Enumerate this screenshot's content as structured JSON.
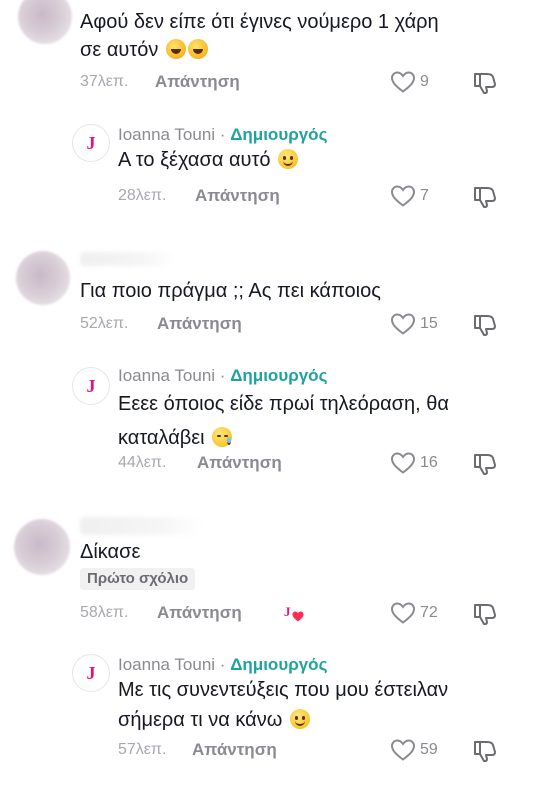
{
  "comments": [
    {
      "text_lines": [
        "Αφού δεν είπε ότι έγινες νούμερο 1 χάρη",
        "σε αυτόν"
      ],
      "time": "37λεπ.",
      "reply_label": "Απάντηση",
      "likes": "9",
      "emoji": "rofl",
      "replies": [
        {
          "author": "Ioanna Touni",
          "separator": "·",
          "role": "Δημιουργός",
          "avatar_letter": "J",
          "text_lines": [
            "Α το ξέχασα αυτό"
          ],
          "time": "28λεπ.",
          "reply_label": "Απάντηση",
          "likes": "7"
        }
      ]
    },
    {
      "text_lines": [
        "Για ποιο πράγμα ;; Ας πει κάποιος"
      ],
      "time": "52λεπ.",
      "reply_label": "Απάντηση",
      "likes": "15",
      "replies": [
        {
          "author": "Ioanna Touni",
          "separator": "·",
          "role": "Δημιουργός",
          "avatar_letter": "J",
          "text_lines": [
            "Εεεε όποιος είδε πρωί τηλεόραση, θα",
            "καταλάβει"
          ],
          "time": "44λεπ.",
          "reply_label": "Απάντηση",
          "likes": "16"
        }
      ]
    },
    {
      "text_lines": [
        "Δίκασε"
      ],
      "badge": "Πρώτο σχόλιο",
      "time": "58λεπ.",
      "reply_label": "Απάντηση",
      "likes": "72",
      "creator_liked": true,
      "replies": [
        {
          "author": "Ioanna Touni",
          "separator": "·",
          "role": "Δημιουργός",
          "avatar_letter": "J",
          "text_lines": [
            "Με τις συνεντεύξεις που μου έστειλαν",
            "σήμερα τι να κάνω"
          ],
          "time": "57λεπ.",
          "reply_label": "Απάντηση",
          "likes": "59"
        }
      ]
    }
  ],
  "icons": {
    "like": "heart-outline-icon",
    "dislike": "thumbs-down-icon",
    "creator_liked": "creator-heart-icon"
  },
  "colors": {
    "creator_role": "#20a39e",
    "creator_brand": "#e5127c",
    "text": "#161823",
    "muted": "#8a8b91"
  }
}
